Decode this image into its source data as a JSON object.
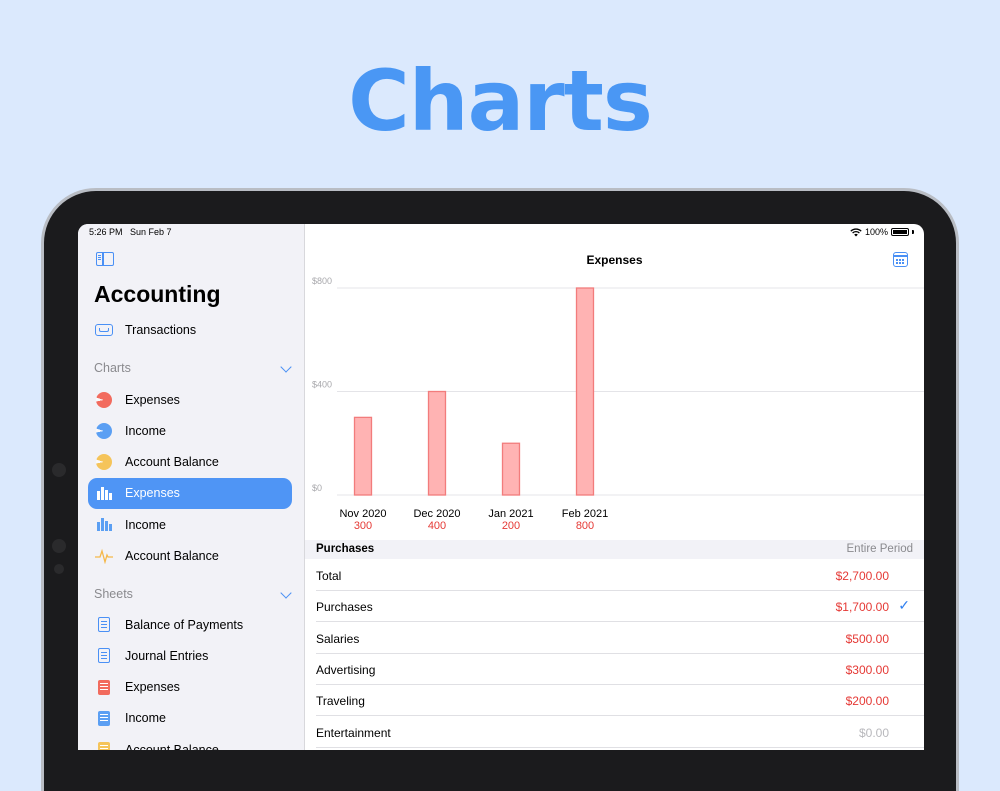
{
  "hero_title": "Charts",
  "status": {
    "time": "5:26 PM",
    "date": "Sun Feb 7",
    "battery": "100%"
  },
  "sidebar": {
    "title": "Accounting",
    "top_item": {
      "label": "Transactions",
      "icon": "tray-icon"
    },
    "charts_section": {
      "header": "Charts",
      "items": [
        {
          "label": "Expenses",
          "icon": "pie-chart-icon",
          "color": "#f26b5e"
        },
        {
          "label": "Income",
          "icon": "pie-chart-icon",
          "color": "#5b9ff3"
        },
        {
          "label": "Account Balance",
          "icon": "pie-chart-icon",
          "color": "#f5c45a"
        },
        {
          "label": "Expenses",
          "icon": "bar-chart-icon",
          "color": "#ffffff",
          "selected": true
        },
        {
          "label": "Income",
          "icon": "bar-chart-icon",
          "color": "#5b9ff3"
        },
        {
          "label": "Account Balance",
          "icon": "waveform-icon",
          "color": "#f5b84a"
        }
      ]
    },
    "sheets_section": {
      "header": "Sheets",
      "items": [
        {
          "label": "Balance of Payments",
          "icon": "document-icon",
          "color": "#4a90f5",
          "style": "outline"
        },
        {
          "label": "Journal Entries",
          "icon": "document-icon",
          "color": "#4a90f5",
          "style": "outline"
        },
        {
          "label": "Expenses",
          "icon": "document-icon",
          "color": "#f26b5e",
          "style": "filled"
        },
        {
          "label": "Income",
          "icon": "document-icon",
          "color": "#5b9ff3",
          "style": "filled"
        },
        {
          "label": "Account Balance",
          "icon": "document-icon",
          "color": "#f5c45a",
          "style": "filled"
        }
      ]
    }
  },
  "main": {
    "title": "Expenses",
    "calendar_icon": "calendar-icon",
    "purchases_header": "Purchases",
    "period_label": "Entire Period",
    "rows": [
      {
        "name": "Total",
        "amount": "$2,700.00",
        "checked": false,
        "muted": false
      },
      {
        "name": "Purchases",
        "amount": "$1,700.00",
        "checked": true,
        "muted": false
      },
      {
        "name": "Salaries",
        "amount": "$500.00",
        "checked": false,
        "muted": false
      },
      {
        "name": "Advertising",
        "amount": "$300.00",
        "checked": false,
        "muted": false
      },
      {
        "name": "Traveling",
        "amount": "$200.00",
        "checked": false,
        "muted": false
      },
      {
        "name": "Entertainment",
        "amount": "$0.00",
        "checked": false,
        "muted": true
      }
    ],
    "check_glyph": "✓"
  },
  "chart_data": {
    "type": "bar",
    "title": "Expenses",
    "categories": [
      "Nov 2020",
      "Dec 2020",
      "Jan 2021",
      "Feb 2021"
    ],
    "values": [
      300,
      400,
      200,
      800
    ],
    "value_labels": [
      "300",
      "400",
      "200",
      "800"
    ],
    "y_ticks": [
      "$0",
      "$400",
      "$800"
    ],
    "y_tick_values": [
      0,
      400,
      800
    ],
    "ylim": [
      0,
      800
    ],
    "grid": true,
    "bar_fill": "#ffb3b3",
    "bar_stroke": "#f27c7c",
    "label_color": "#e53935"
  }
}
